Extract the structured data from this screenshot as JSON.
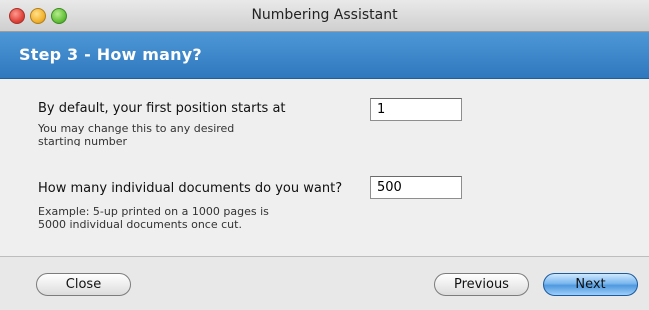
{
  "window": {
    "title": "Numbering Assistant"
  },
  "header": {
    "step_title": "Step 3 - How many?"
  },
  "form": {
    "start": {
      "label": "By default, your first position starts at",
      "hint_line1": "You may change this to any desired",
      "hint_line2": "starting number",
      "value": "1"
    },
    "count": {
      "label": "How many individual documents do you want?",
      "hint_line1": "Example: 5-up printed on a 1000 pages is",
      "hint_line2": "5000 individual documents once cut.",
      "value": "500"
    }
  },
  "footer": {
    "close_label": "Close",
    "previous_label": "Previous",
    "next_label": "Next"
  },
  "colors": {
    "header_blue": "#3f88cb",
    "default_button_blue": "#6eaee9"
  }
}
